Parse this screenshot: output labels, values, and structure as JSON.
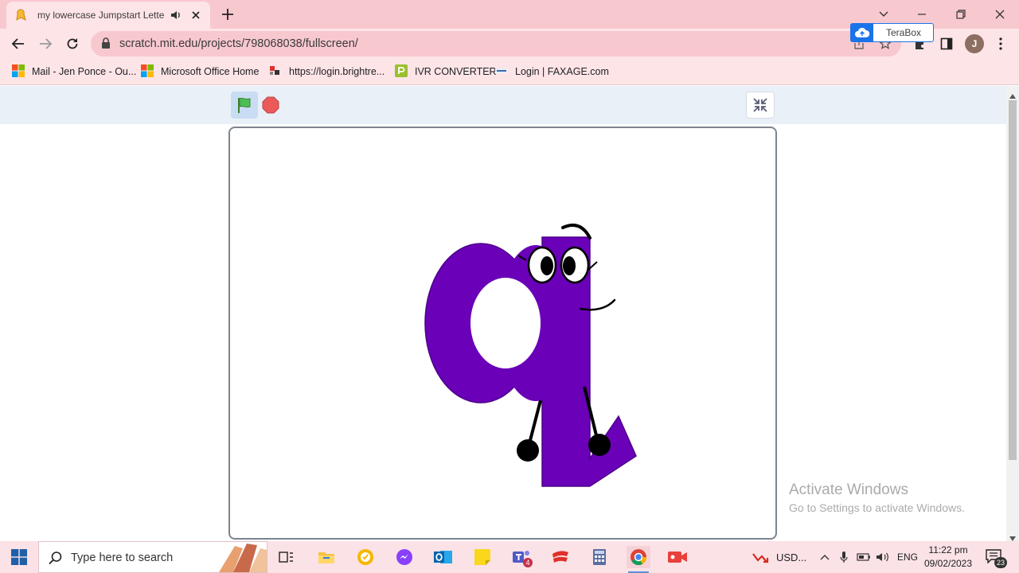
{
  "browser": {
    "tab": {
      "title": "my lowercase Jumpstart Letters",
      "favicon": "scratch-cat-favicon",
      "audio_icon": "speaker-playing-icon"
    },
    "address_bar": {
      "url": "scratch.mit.edu/projects/798068038/fullscreen/"
    },
    "extension_popup": {
      "label": "TeraBox"
    },
    "profile_initial": "J",
    "bookmarks": [
      {
        "label": "Mail - Jen Ponce - Ou...",
        "icon": "microsoft-logo-icon"
      },
      {
        "label": "Microsoft Office Home",
        "icon": "microsoft-logo-icon"
      },
      {
        "label": "https://login.brightre...",
        "icon": "brightree-icon"
      },
      {
        "label": "IVR CONVERTER",
        "icon": "ivr-converter-icon"
      },
      {
        "label": "Login | FAXAGE.com",
        "icon": "faxage-icon"
      }
    ]
  },
  "scratch": {
    "controls": {
      "green_flag": "green-flag-icon",
      "stop": "stop-icon",
      "exit_fullscreen": "exit-fullscreen-icon"
    },
    "stage_sprite": "lowercase-q-character"
  },
  "watermark": {
    "line1": "Activate Windows",
    "line2": "Go to Settings to activate Windows."
  },
  "taskbar": {
    "search_placeholder": "Type here to search",
    "apps": [
      "task-view-icon",
      "file-explorer-icon",
      "norton-icon",
      "messenger-icon",
      "outlook-icon",
      "sticky-notes-icon",
      "teams-icon",
      "app-red-icon",
      "calculator-icon",
      "chrome-icon",
      "video-recorder-icon"
    ],
    "teams_badge": "4",
    "tray": {
      "stock_label": "USD...",
      "language": "ENG"
    },
    "clock": {
      "time": "11:22 pm",
      "date": "09/02/2023"
    },
    "notification_count": "23"
  },
  "colors": {
    "tab_strip": "#f8c8cf",
    "toolbar": "#fde4e7",
    "stage_header": "#e9f0f7",
    "letter_purple": "#6a00b8"
  }
}
